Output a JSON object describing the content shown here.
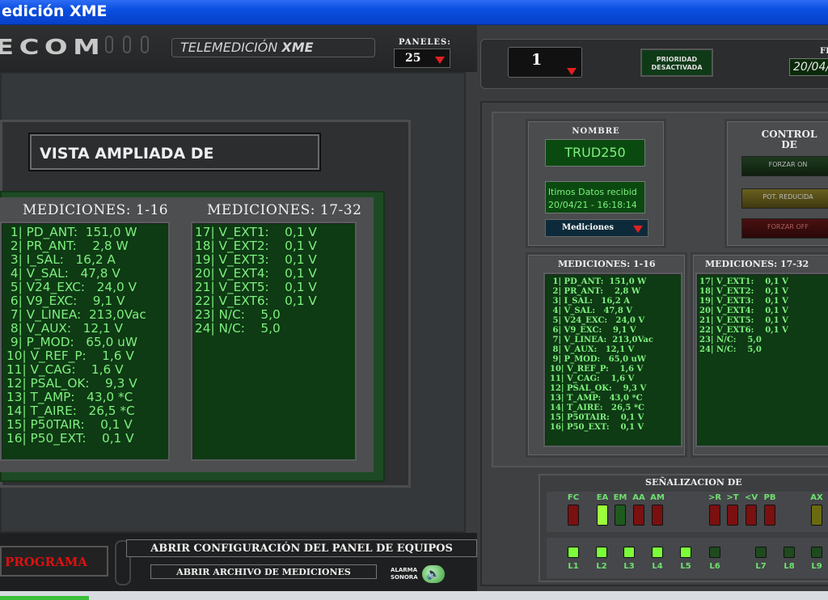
{
  "window": {
    "title": "edición XME"
  },
  "header": {
    "logo_text": "ECOM",
    "telemed_prefix": "TELEMEDICIÓN",
    "telemed_suffix": "XME",
    "paneles_label": "PANELES:",
    "paneles_value": "25",
    "panel_selector_value": "1",
    "prioridad_line1": "PRIORIDAD",
    "prioridad_line2": "DESACTIVADA",
    "fecha_label": "FE",
    "fecha_value": "20/04/"
  },
  "left_panel": {
    "vista_title": "VISTA AMPLIADA DE",
    "col1_title": "MEDICIONES: 1-16",
    "col2_title": "MEDICIONES: 17-32",
    "col1": [
      " 1| PD_ANT:  151,0 W",
      " 2| PR_ANT:    2,8 W",
      " 3| I_SAL:   16,2 A",
      " 4| V_SAL:   47,8 V",
      " 5| V24_EXC:   24,0 V",
      " 6| V9_EXC:    9,1 V",
      " 7| V_LINEA:  213,0Vac",
      " 8| V_AUX:   12,1 V",
      " 9| P_MOD:   65,0 uW",
      "10| V_REF_P:    1,6 V",
      "11| V_CAG:    1,6 V",
      "12| PSAL_OK:    9,3 V",
      "13| T_AMP:   43,0 *C",
      "14| T_AIRE:   26,5 *C",
      "15| P50TAIR:    0,1 V",
      "16| P50_EXT:    0,1 V"
    ],
    "col2": [
      "17| V_EXT1:    0,1 V",
      "18| V_EXT2:    0,1 V",
      "19| V_EXT3:    0,1 V",
      "20| V_EXT4:    0,1 V",
      "21| V_EXT5:    0,1 V",
      "22| V_EXT6:    0,1 V",
      "23| N/C:    5,0",
      "24| N/C:    5,0"
    ]
  },
  "bottom": {
    "programa": "PROGRAMA",
    "abrir_config": "ABRIR CONFIGURACIÓN DEL PANEL DE EQUIPOS",
    "abrir_archivo": "ABRIR ARCHIVO DE MEDICIONES",
    "alarma_line1": "ALARMA",
    "alarma_line2": "SONORA"
  },
  "right_panel": {
    "nombre_label": "NOMBRE",
    "nombre_value": "TRUD250",
    "ultimos_label": "ltimos Datos recibid",
    "ultimos_value": "20/04/21 - 16:18:14",
    "mediciones_select": "Mediciones",
    "control_line1": "CONTROL",
    "control_line2": "DE",
    "forzar_on": "FORZAR ON",
    "pot_reducida": "POT. REDUCIDA",
    "forzar_off": "FORZAR OFF",
    "col1_title": "MEDICIONES: 1-16",
    "col2_title": "MEDICIONES: 17-32",
    "col1": [
      " 1| PD_ANT:  151,0 W",
      " 2| PR_ANT:    2,8 W",
      " 3| I_SAL:   16,2 A",
      " 4| V_SAL:   47,8 V",
      " 5| V24_EXC:   24,0 V",
      " 6| V9_EXC:    9,1 V",
      " 7| V_LINEA:  213,0Vac",
      " 8| V_AUX:   12,1 V",
      " 9| P_MOD:   65,0 uW",
      "10| V_REF_P:    1,6 V",
      "11| V_CAG:    1,6 V",
      "12| PSAL_OK:    9,3 V",
      "13| T_AMP:   43,0 *C",
      "14| T_AIRE:   26,5 *C",
      "15| P50TAIR:    0,1 V",
      "16| P50_EXT:    0,1 V"
    ],
    "col2": [
      "17| V_EXT1:    0,1 V",
      "18| V_EXT2:    0,1 V",
      "19| V_EXT3:    0,1 V",
      "20| V_EXT4:    0,1 V",
      "21| V_EXT5:    0,1 V",
      "22| V_EXT6:    0,1 V",
      "23| N/C:    5,0",
      "24| N/C:    5,0"
    ],
    "senal_title": "SEÑALIZACION DE",
    "signals": [
      {
        "label": "FC",
        "color": "#7a1010"
      },
      {
        "label": "EA",
        "color": "#9cff3c"
      },
      {
        "label": "EM",
        "color": "#1e5a1e"
      },
      {
        "label": "AA",
        "color": "#7a1010"
      },
      {
        "label": "AM",
        "color": "#7a1010"
      },
      {
        "label": ">R",
        "color": "#7a1010"
      },
      {
        "label": ">T",
        "color": "#7a1010"
      },
      {
        "label": "<V",
        "color": "#7a1010"
      },
      {
        "label": "PB",
        "color": "#7a1010"
      },
      {
        "label": "AX",
        "color": "#6a6a10"
      }
    ],
    "lines": [
      {
        "label": "L1",
        "color": "#7cff3a"
      },
      {
        "label": "L2",
        "color": "#7cff3a"
      },
      {
        "label": "L3",
        "color": "#7cff3a"
      },
      {
        "label": "L4",
        "color": "#7cff3a"
      },
      {
        "label": "L5",
        "color": "#7cff3a"
      },
      {
        "label": "L6",
        "color": "#1e4a1e"
      },
      {
        "label": "L7",
        "color": "#1e4a1e"
      },
      {
        "label": "L8",
        "color": "#1e4a1e"
      },
      {
        "label": "L9",
        "color": "#1e4a1e"
      }
    ]
  }
}
